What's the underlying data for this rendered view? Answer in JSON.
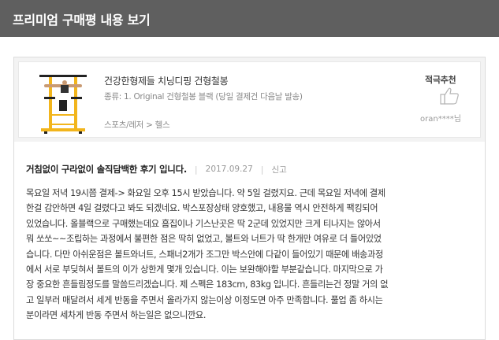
{
  "header": {
    "title": "프리미엄 구매평 내용 보기"
  },
  "product": {
    "name": "건강한형제들 치닝디핑 건형철봉",
    "option": "종류: 1. Original 건형철봉 블랙 (당일 결제건 다음날 발송)",
    "category": "스포츠/레저 > 헬스",
    "recommend_label": "적극추천",
    "reviewer": "oran****님",
    "icons": {
      "product_image": "chin-up-bar-photo",
      "recommend": "thumbs-up-icon"
    },
    "colors": {
      "frame": "#f2b51c",
      "accent": "#222222"
    }
  },
  "review": {
    "title": "거침없이 구라없이 솔직담백한 후기 입니다.",
    "date": "2017.09.27",
    "report_label": "신고",
    "lines": [
      "목요일 저녁 19시쯤 결제-> 화요일 오후 15시 받았습니다. 약 5일 걸렸지요. 근데 목요일 저녁에 결제",
      "한걸 감안하면 4일 걸렸다고 봐도 되겠네요. 박스포장상태 양호했고, 내용물 역시 안전하게 팩킹되어",
      "있었습니다. 올블랙으로 구매했는데요 흠집이나 기스난곳은 딱 2군데 있었지만 크게 티나지는 않아서",
      "뭐 쏘쏘~~조립하는 과정에서 불편한 점은 딱히 없었고, 볼트와 너트가 딱 한개만 여유로 더 들어있었",
      "습니다. 다만 아쉬운점은 볼트와너트, 스패너2개가 조그만 박스안에 다같이 들어있기 때문에 배송과정",
      "에서 서로 부딪혀서 볼트의 이가 상한게 몇개 있습니다. 이는 보완해야할 부분같습니다. 마지막으로 가",
      "장 중요한 흔들림정도를 말씀드리겠습니다. 제 스펙은 183cm, 83kg 입니다. 흔들리는건 정말 거의 없",
      "고 일부러 매달려서 세게 반동을 주면서 올라가지 않는이상 이정도면 아주 만족합니다. 풀업 좀 하시는",
      "분이라면 세차게 반동 주면서 하는일은 없으니깐요."
    ]
  }
}
